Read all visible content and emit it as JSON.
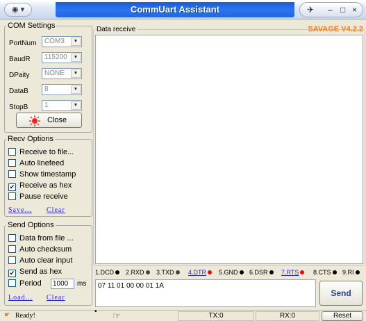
{
  "window": {
    "title": "CommUart Assistant",
    "sys_menu": "▾",
    "min": "–",
    "max": "□",
    "close": "×"
  },
  "com_settings": {
    "legend": "COM Settings",
    "portnum_label": "PortNum",
    "portnum_value": "COM3",
    "baudr_label": "BaudR",
    "baudr_value": "115200",
    "dpaity_label": "DPaity",
    "dpaity_value": "NONE",
    "datab_label": "DataB",
    "datab_value": "8",
    "stopb_label": "StopB",
    "stopb_value": "1",
    "close_label": "Close"
  },
  "recv_options": {
    "legend": "Recv Options",
    "items": [
      {
        "label": "Receive to file...",
        "checked": false
      },
      {
        "label": "Auto linefeed",
        "checked": false
      },
      {
        "label": "Show timestamp",
        "checked": false
      },
      {
        "label": "Receive as hex",
        "checked": true
      },
      {
        "label": "Pause receive",
        "checked": false
      }
    ],
    "save_link": "Save...",
    "clear_link": "Clear"
  },
  "send_options": {
    "legend": "Send Options",
    "items": [
      {
        "label": "Data from file ...",
        "checked": false
      },
      {
        "label": "Auto checksum",
        "checked": false
      },
      {
        "label": "Auto clear input",
        "checked": false
      },
      {
        "label": "Send as hex",
        "checked": true
      }
    ],
    "period_label": "Period",
    "period_value": "1000",
    "period_unit": "ms",
    "period_checked": false,
    "load_link": "Load...",
    "clear_link": "Clear"
  },
  "data_receive": {
    "label": "Data receive",
    "version": "SAVAGE V4.2.2"
  },
  "signals": [
    {
      "label": "1.DCD",
      "color": "#000000",
      "link": false
    },
    {
      "label": "2.RXD",
      "color": "#444444",
      "link": false
    },
    {
      "label": "3.TXD",
      "color": "#444444",
      "link": false
    },
    {
      "label": "4.DTR",
      "color": "#e01010",
      "link": true
    },
    {
      "label": "5.GND",
      "color": "#000000",
      "link": false
    },
    {
      "label": "6.DSR",
      "color": "#000000",
      "link": false
    },
    {
      "label": "7.RTS",
      "color": "#e01010",
      "link": true
    },
    {
      "label": "8.CTS",
      "color": "#000000",
      "link": false
    },
    {
      "label": "9.RI",
      "color": "#000000",
      "link": false
    }
  ],
  "send": {
    "data": "07 11 01 00 00 01 1A",
    "button": "Send"
  },
  "statusbar": {
    "status": "Ready!",
    "tx": "TX:0",
    "rx": "RX:0",
    "reset": "Reset"
  }
}
